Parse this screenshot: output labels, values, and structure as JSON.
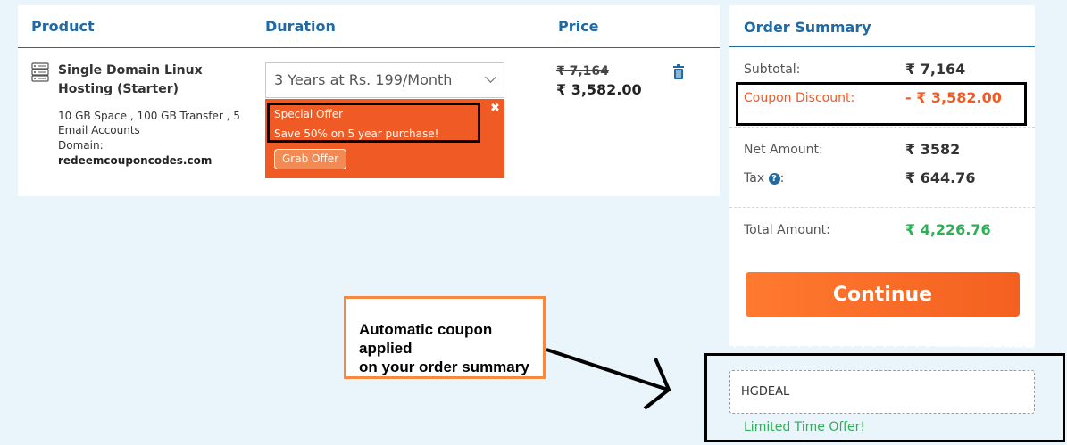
{
  "table": {
    "headers": {
      "product": "Product",
      "duration": "Duration",
      "price": "Price"
    }
  },
  "product": {
    "title": "Single Domain Linux Hosting (Starter)",
    "features": "10 GB Space , 100 GB Transfer , 5 Email Accounts",
    "domain_label": "Domain:",
    "domain": "redeemcouponcodes.com",
    "icon": "server-icon"
  },
  "duration": {
    "selected": "3 Years at Rs. 199/Month"
  },
  "offer": {
    "title": "Special Offer",
    "text": "Save 50% on 5 year purchase!",
    "close": "✖",
    "button": "Grab Offer"
  },
  "price": {
    "original": "₹ 7,164",
    "discounted": "₹ 3,582.00"
  },
  "summary": {
    "title": "Order Summary",
    "subtotal_label": "Subtotal:",
    "subtotal_value": "₹ 7,164",
    "discount_label": "Coupon Discount:",
    "discount_value": "- ₹ 3,582.00",
    "net_label": "Net Amount:",
    "net_value": "₹ 3582",
    "tax_label": "Tax",
    "tax_help": "?",
    "tax_colon": ":",
    "tax_value": "₹ 644.76",
    "total_label": "Total Amount:",
    "total_value": "₹ 4,226.76",
    "continue": "Continue"
  },
  "coupon": {
    "code": "HGDEAL",
    "note": "Limited Time Offer!"
  },
  "annotation": {
    "line1": "Automatic coupon applied",
    "line2": "on your order summary"
  },
  "colors": {
    "heading_blue": "#1f6aa5",
    "offer_orange": "#f05a24",
    "discount_orange": "#f05a24",
    "total_green": "#2eae57",
    "annotation_border": "#f7883f"
  }
}
